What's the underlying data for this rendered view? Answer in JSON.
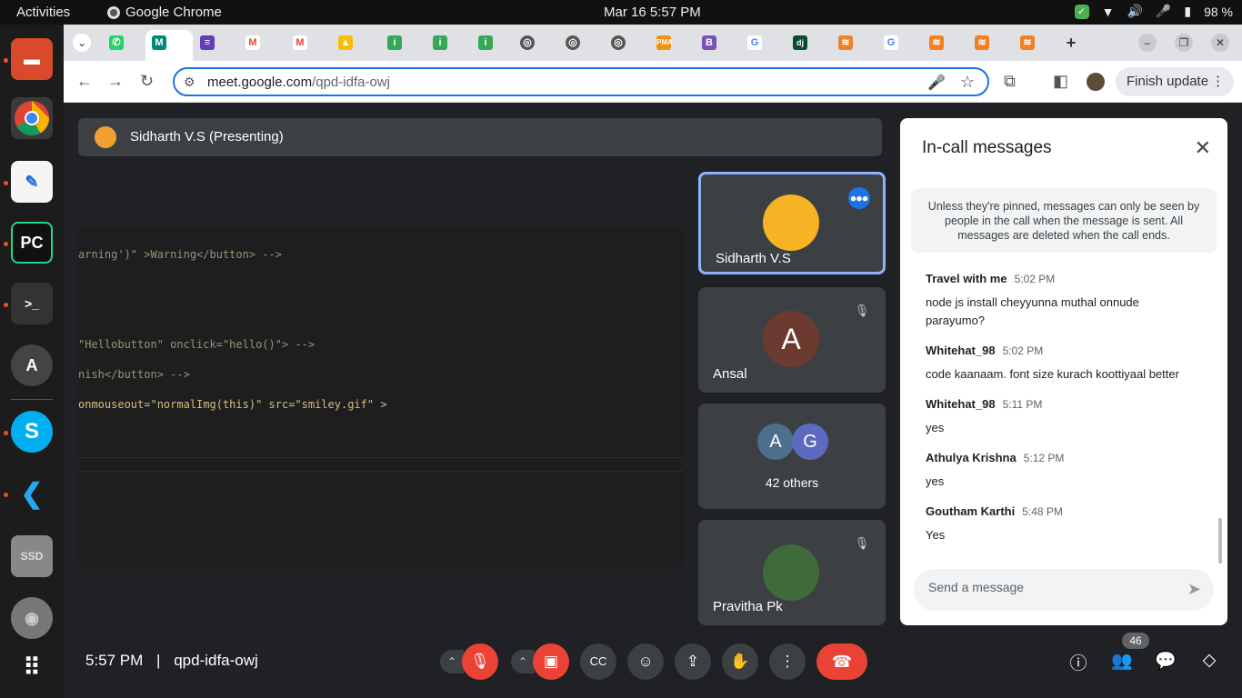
{
  "topbar": {
    "activities": "Activities",
    "app": "Google Chrome",
    "clock": "Mar 16  5:57 PM",
    "battery": "98 %"
  },
  "dock": [
    "files-app",
    "chrome",
    "text-editor",
    "pycharm",
    "terminal",
    "software-updater",
    "skype",
    "vscode",
    "ssd-drive",
    "disk",
    "show-apps"
  ],
  "browser": {
    "url_host": "meet.google.com",
    "url_path": "/qpd-idfa-owj",
    "finish_update": "Finish update",
    "tabs": [
      "whatsapp",
      "meet",
      "forms",
      "gmail",
      "gmail",
      "drive",
      "tab-green",
      "tab-green",
      "tab-green",
      "tab-globe",
      "tab-globe",
      "tab-globe",
      "phpmyadmin",
      "bootstrap",
      "google",
      "django",
      "stackoverflow",
      "google",
      "stackoverflow",
      "stackoverflow",
      "stackoverflow"
    ]
  },
  "meet": {
    "presenter": "Sidharth V.S (Presenting)",
    "code_lines": [
      "arning')\" >Warning</button> -->",
      "\"Hellobutton\" onclick=\"hello()\"> -->",
      "nish</button> -->",
      "onmouseout=\"normalImg(this)\" src=\"smiley.gif\" >"
    ],
    "tiles": {
      "sidharth": "Sidharth V.S",
      "ansal": "Ansal",
      "ansal_initial": "A",
      "others_initial_a": "A",
      "others_initial_g": "G",
      "others": "42 others",
      "pravitha": "Pravitha Pk"
    },
    "panel": {
      "title": "In-call messages",
      "notice": "Unless they're pinned, messages can only be seen by people in the call when the message is sent. All messages are deleted when the call ends.",
      "messages": [
        {
          "sender": "Travel with me",
          "time": "5:02 PM",
          "text": "node js install cheyyunna muthal onnude parayumo?"
        },
        {
          "sender": "Whitehat_98",
          "time": "5:02 PM",
          "text": "code kaanaam. font size kurach koottiyaal better"
        },
        {
          "sender": "Whitehat_98",
          "time": "5:11 PM",
          "text": "yes"
        },
        {
          "sender": "Athulya Krishna",
          "time": "5:12 PM",
          "text": "yes"
        },
        {
          "sender": "Goutham Karthi",
          "time": "5:48 PM",
          "text": "Yes"
        }
      ],
      "send_placeholder": "Send a message"
    },
    "bottom": {
      "time": "5:57 PM",
      "separator": "|",
      "code": "qpd-idfa-owj",
      "participants": "46"
    }
  },
  "colors": {
    "accent": "#1a73e8",
    "danger": "#ea4335",
    "surface": "#3c4043",
    "background": "#202124"
  }
}
